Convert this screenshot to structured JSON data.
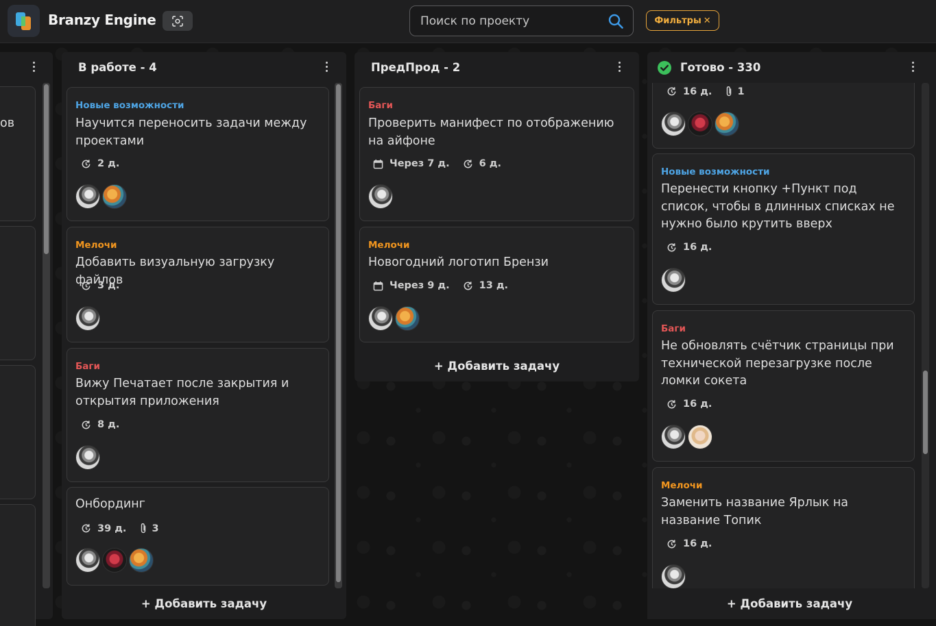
{
  "app": {
    "title": "Branzy Engine"
  },
  "header": {
    "search_placeholder": "Поиск по проекту",
    "filters_label": "Фильтры",
    "filters_close": "✕"
  },
  "colors": {
    "features": "#4ea4e4",
    "small": "#f2961f",
    "bugs": "#e35656",
    "done_check": "#3cbf5b",
    "filter_accent": "#e8a43a"
  },
  "left_partial": {
    "snippet": "ов"
  },
  "columns": [
    {
      "title": "В работе - 4",
      "cards": [
        {
          "tag": "Новые возможности",
          "title": "Научится переносить задачи между проектами",
          "age": "2 д."
        },
        {
          "tag": "Мелочи",
          "title": "Добавить визуальную загрузку файлов",
          "age": "3 д."
        },
        {
          "tag": "Баги",
          "title": "Вижу Печатает после закрытия и открытия приложения",
          "age": "8 д."
        },
        {
          "tag": "",
          "title": "Онбординг",
          "age": "39 д.",
          "attachments": "3"
        }
      ],
      "add_label": "+ Добавить задачу"
    },
    {
      "title": "ПредПрод - 2",
      "cards": [
        {
          "tag": "Баги",
          "title": "Проверить манифест по отображению на айфоне",
          "due": "Через 7 д.",
          "age": "6 д."
        },
        {
          "tag": "Мелочи",
          "title": "Новогодний логотип Брензи",
          "due": "Через 9 д.",
          "age": "13 д."
        }
      ],
      "add_label": "+ Добавить задачу"
    },
    {
      "title": "Готово - 330",
      "cards": [
        {
          "tag": "",
          "title": "",
          "age": "16 д.",
          "attachments": "1"
        },
        {
          "tag": "Новые возможности",
          "title": "Перенести кнопку +Пункт под список, чтобы в длинных списках не нужно было крутить вверх",
          "age": "16 д."
        },
        {
          "tag": "Баги",
          "title": "Не обновлять счётчик страницы при технической перезагрузке после ломки сокета",
          "age": "16 д."
        },
        {
          "tag": "Мелочи",
          "title": "Заменить название Ярлык на название Топик",
          "age": "16 д."
        }
      ],
      "add_label": "+ Добавить задачу"
    }
  ]
}
